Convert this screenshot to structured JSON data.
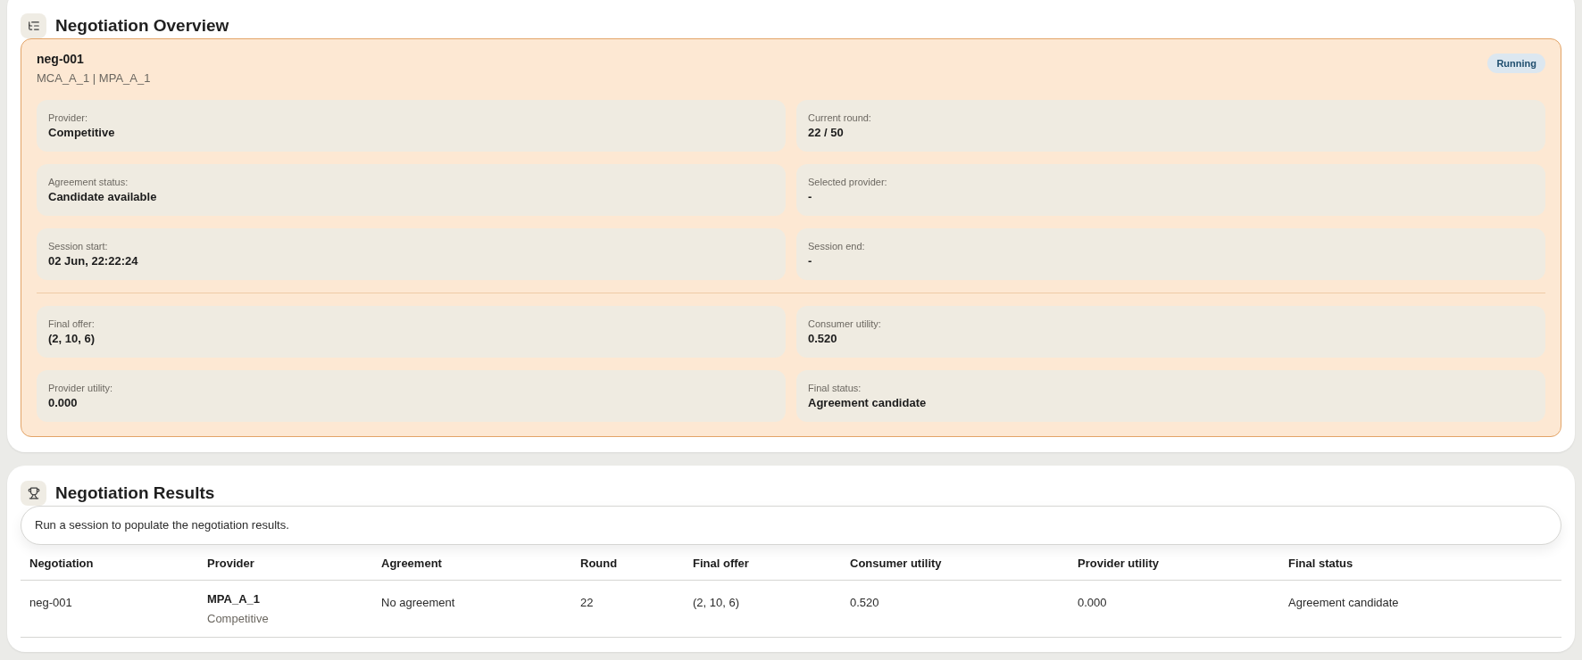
{
  "overview": {
    "title": "Negotiation Overview",
    "negotiation": {
      "id": "neg-001",
      "parties": "MCA_A_1 | MPA_A_1",
      "status": "Running",
      "details": [
        {
          "label": "Provider:",
          "value": "Competitive"
        },
        {
          "label": "Current round:",
          "value": "22 / 50"
        },
        {
          "label": "Agreement status:",
          "value": "Candidate available"
        },
        {
          "label": "Selected provider:",
          "value": "-"
        },
        {
          "label": "Session start:",
          "value": "02 Jun, 22:22:24"
        },
        {
          "label": "Session end:",
          "value": "-"
        }
      ],
      "outcome": [
        {
          "label": "Final offer:",
          "value": "(2, 10, 6)"
        },
        {
          "label": "Consumer utility:",
          "value": "0.520"
        },
        {
          "label": "Provider utility:",
          "value": "0.000"
        },
        {
          "label": "Final status:",
          "value": "Agreement candidate"
        }
      ]
    }
  },
  "results": {
    "title": "Negotiation Results",
    "message": "Run a session to populate the negotiation results.",
    "table": {
      "columns": [
        "Negotiation",
        "Provider",
        "Agreement",
        "Round",
        "Final offer",
        "Consumer utility",
        "Provider utility",
        "Final status"
      ],
      "rows": [
        {
          "cells": [
            {
              "kind": "plain",
              "text": "neg-001"
            },
            {
              "kind": "stacked",
              "text": "MPA_A_1",
              "subtext": "Competitive"
            },
            {
              "kind": "plain",
              "text": "No agreement"
            },
            {
              "kind": "plain",
              "text": "22"
            },
            {
              "kind": "plain",
              "text": "(2, 10, 6)"
            },
            {
              "kind": "plain",
              "text": "0.520"
            },
            {
              "kind": "plain",
              "text": "0.000"
            },
            {
              "kind": "plain",
              "text": "Agreement candidate"
            }
          ]
        }
      ]
    }
  }
}
